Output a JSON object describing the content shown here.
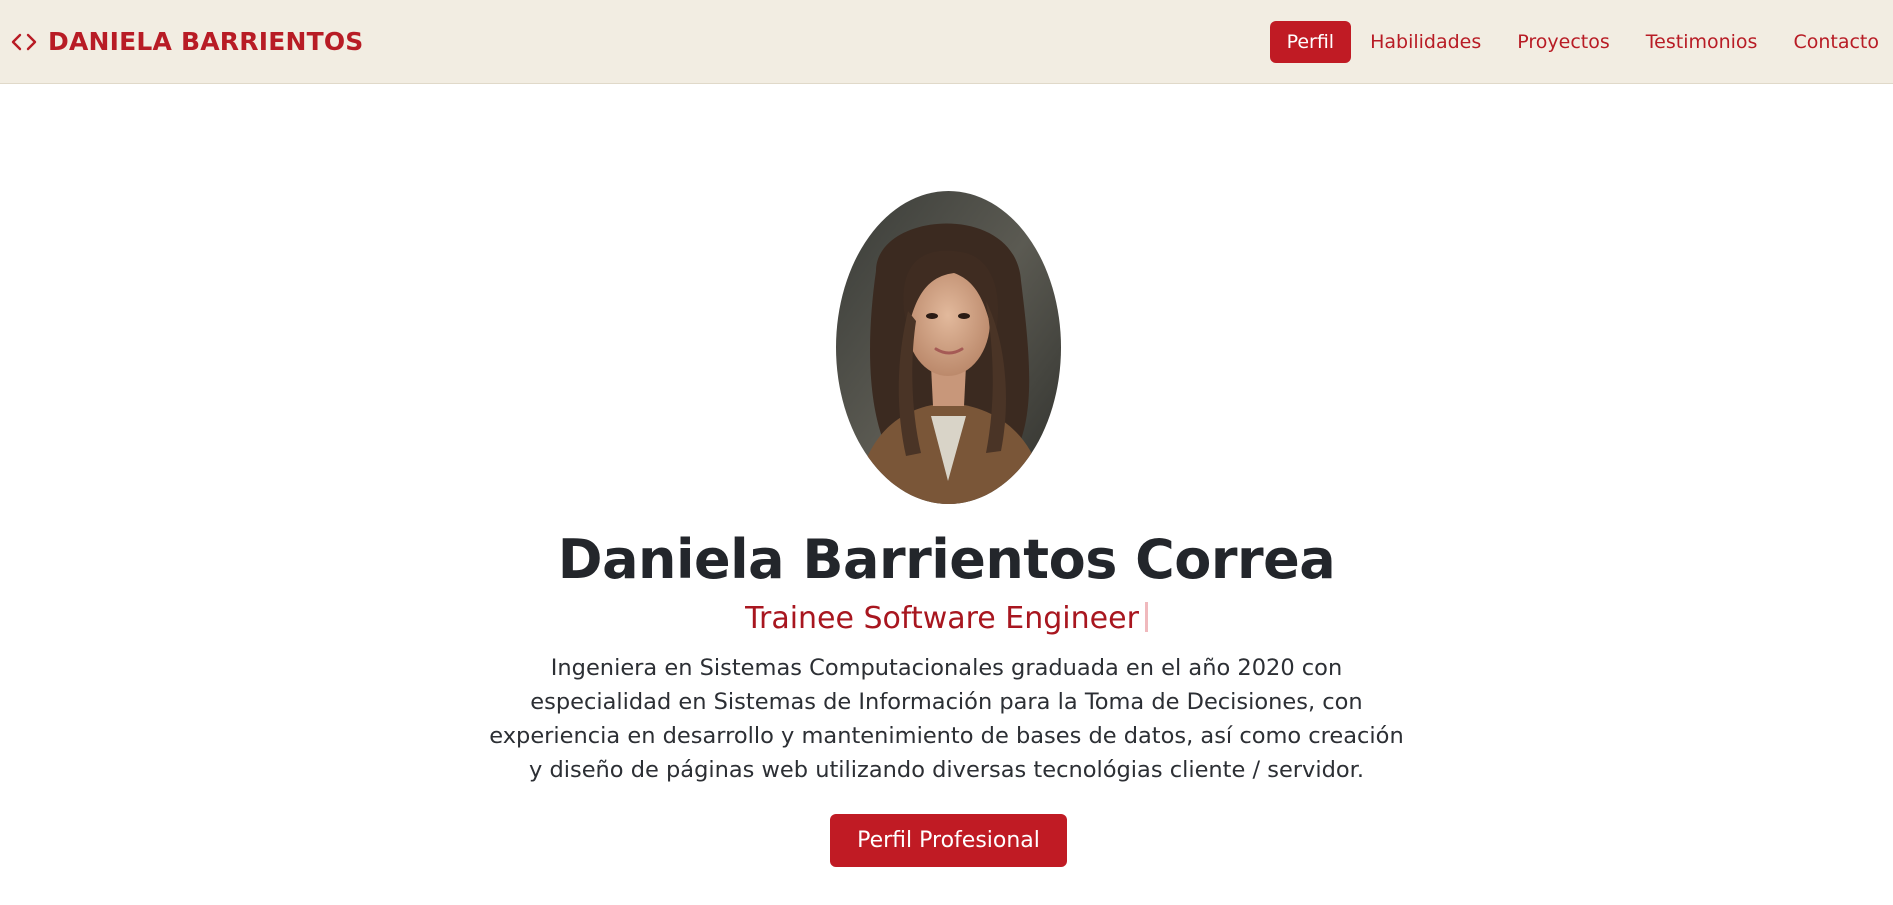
{
  "header": {
    "brand_name": "DANIELA BARRIENTOS",
    "nav": [
      {
        "label": "Perfil"
      },
      {
        "label": "Habilidades"
      },
      {
        "label": "Proyectos"
      },
      {
        "label": "Testimonios"
      },
      {
        "label": "Contacto"
      }
    ],
    "active_nav": "Perfil"
  },
  "hero": {
    "name": "Daniela Barrientos Correa",
    "role": "Trainee Software Engineer",
    "bio_lines": [
      "Ingeniera en Sistemas Computacionales graduada en el año 2020 con",
      "especialidad en Sistemas de Información para la Toma de Decisiones, con",
      "experiencia en desarrollo y mantenimiento de bases de datos, así como creación",
      "y diseño de páginas web utilizando diversas tecnológias cliente / servidor."
    ],
    "cta_label": "Perfil Profesional"
  },
  "icons": {
    "brand": "code-brackets-icon"
  },
  "colors": {
    "accent": "#c01b24",
    "accent_text": "#b81c25",
    "header_bg": "#f2ede2",
    "text": "#23262b"
  }
}
